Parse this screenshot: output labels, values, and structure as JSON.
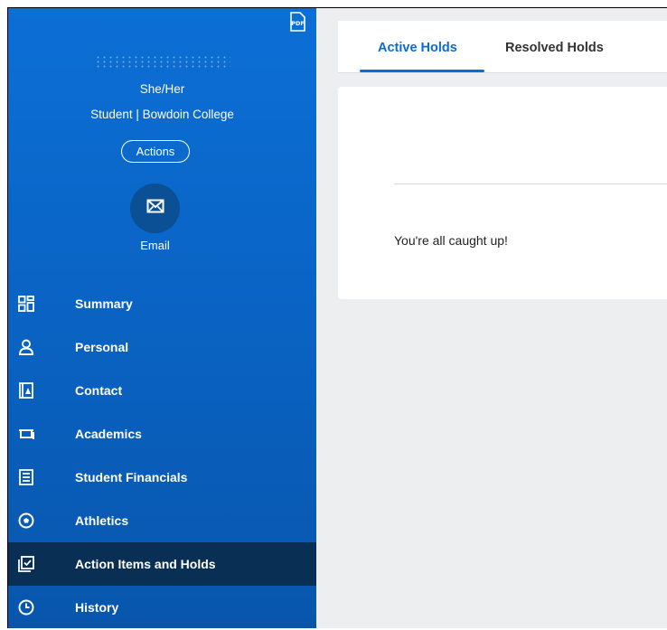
{
  "sidebar": {
    "pdf_icon": "pdf-icon",
    "pronouns": "She/Her",
    "subtitle": "Student | Bowdoin College",
    "actions_label": "Actions",
    "email_label": "Email",
    "nav_items": [
      {
        "label": "Summary",
        "icon": "grid-icon"
      },
      {
        "label": "Personal",
        "icon": "person-icon"
      },
      {
        "label": "Contact",
        "icon": "contact-card-icon"
      },
      {
        "label": "Academics",
        "icon": "mortarboard-icon"
      },
      {
        "label": "Student Financials",
        "icon": "document-list-icon"
      },
      {
        "label": "Athletics",
        "icon": "soccer-ball-icon"
      },
      {
        "label": "Action Items and Holds",
        "icon": "checklist-icon",
        "active": true
      },
      {
        "label": "History",
        "icon": "clock-icon"
      }
    ]
  },
  "main": {
    "tabs": [
      {
        "label": "Active Holds",
        "active": true
      },
      {
        "label": "Resolved Holds",
        "active": false
      }
    ],
    "empty_message": "You're all caught up!"
  },
  "colors": {
    "sidebar_blue": "#0a64c5",
    "active_nav": "#0a2f55",
    "accent": "#0b6bd1",
    "main_bg": "#eceef0"
  }
}
